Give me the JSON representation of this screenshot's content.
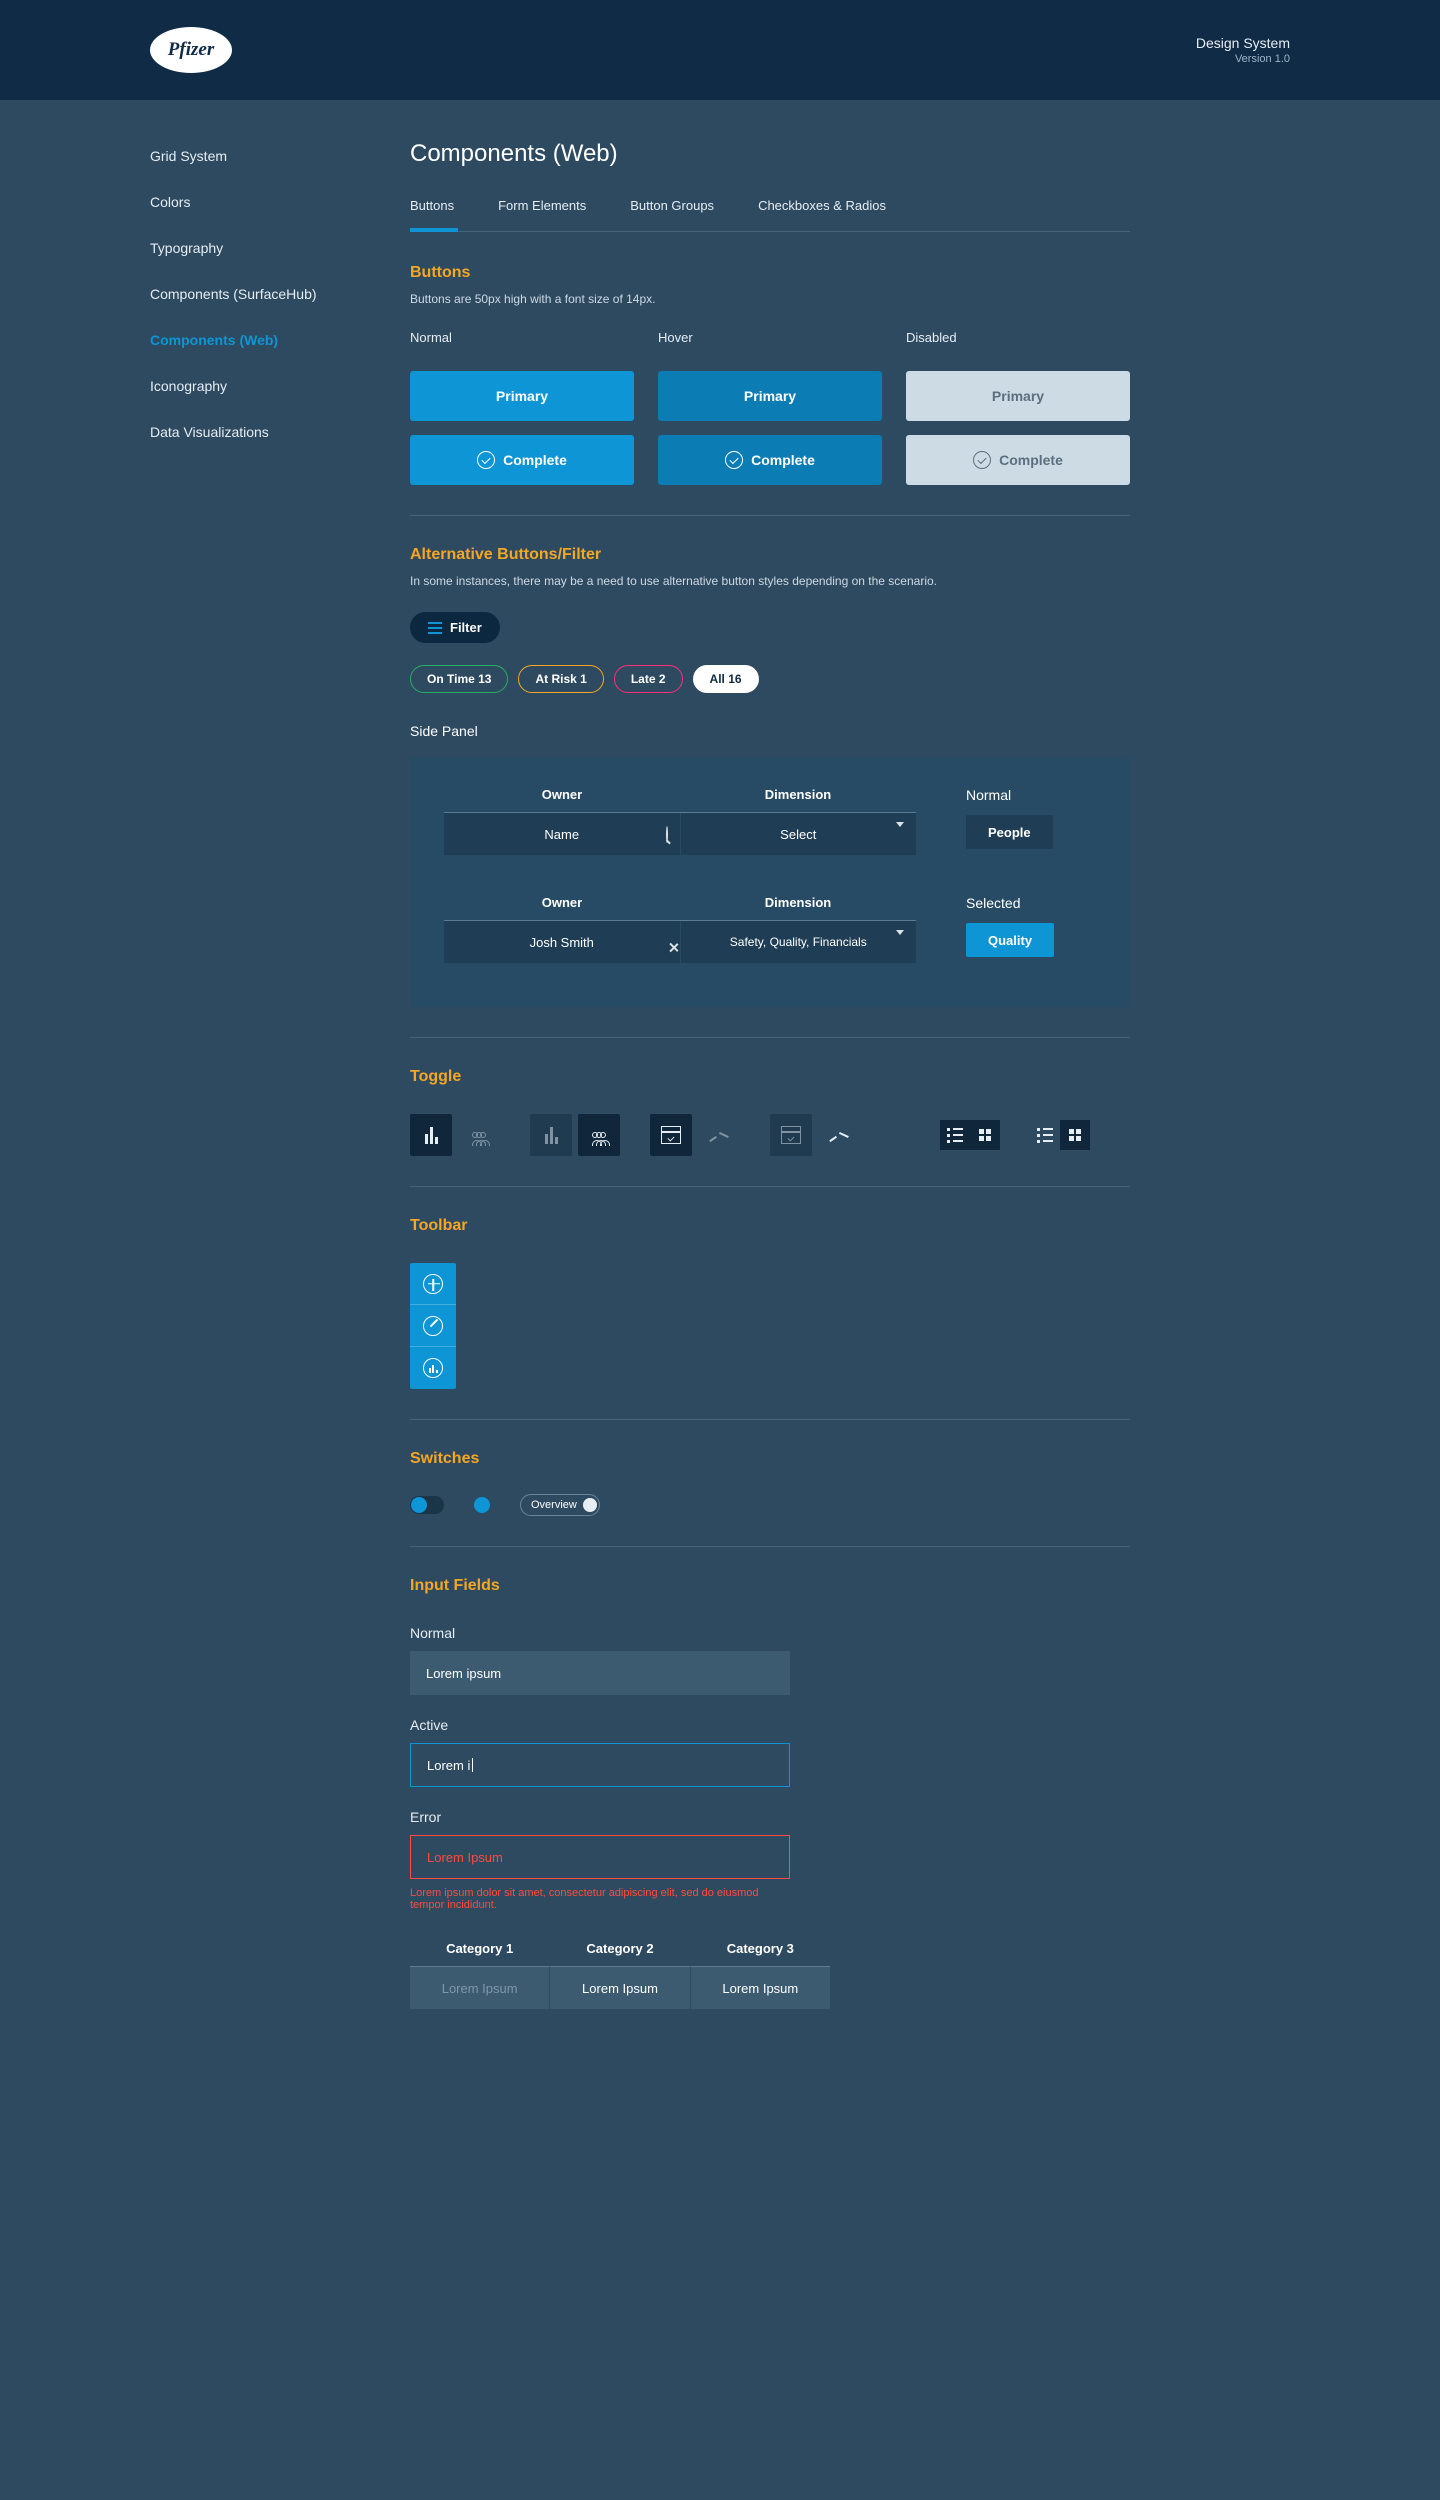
{
  "header": {
    "brand": "Pfizer",
    "title": "Design System",
    "version": "Version 1.0"
  },
  "sidebar": {
    "items": [
      {
        "label": "Grid System"
      },
      {
        "label": "Colors"
      },
      {
        "label": "Typography"
      },
      {
        "label": "Components (SurfaceHub)"
      },
      {
        "label": "Components (Web)",
        "active": true
      },
      {
        "label": "Iconography"
      },
      {
        "label": "Data Visualizations"
      }
    ]
  },
  "page": {
    "title": "Components (Web)"
  },
  "tabs": [
    {
      "label": "Buttons",
      "active": true
    },
    {
      "label": "Form Elements"
    },
    {
      "label": "Button Groups"
    },
    {
      "label": "Checkboxes & Radios"
    }
  ],
  "buttons": {
    "title": "Buttons",
    "desc": "Buttons are 50px high with a font size of 14px.",
    "states": {
      "normal": "Normal",
      "hover": "Hover",
      "disabled": "Disabled"
    },
    "primary_label": "Primary",
    "complete_label": "Complete"
  },
  "alt": {
    "title": "Alternative Buttons/Filter",
    "desc": "In some instances, there may be a need to use alternative button styles depending on the scenario.",
    "filter_label": "Filter",
    "pills": {
      "ontime": "On Time 13",
      "atrisk": "At Risk 1",
      "late": "Late 2",
      "all": "All 16"
    }
  },
  "sidepanel": {
    "title": "Side Panel",
    "owner_header": "Owner",
    "dimension_header": "Dimension",
    "normal": {
      "label": "Normal",
      "owner": "Name",
      "dimension": "Select",
      "chip": "People"
    },
    "selected": {
      "label": "Selected",
      "owner": "Josh Smith",
      "dimension": "Safety, Quality, Financials",
      "chip": "Quality"
    }
  },
  "toggle": {
    "title": "Toggle"
  },
  "toolbar": {
    "title": "Toolbar"
  },
  "switches": {
    "title": "Switches",
    "overview": "Overview"
  },
  "inputs": {
    "title": "Input Fields",
    "normal_label": "Normal",
    "normal_value": "Lorem ipsum",
    "active_label": "Active",
    "active_value": "Lorem i",
    "error_label": "Error",
    "error_value": "Lorem Ipsum",
    "error_msg": "Lorem ipsum dolor sit amet, consectetur adipiscing elit, sed do eiusmod tempor incididunt."
  },
  "categories": {
    "headers": [
      "Category 1",
      "Category 2",
      "Category 3"
    ],
    "values": [
      "Lorem Ipsum",
      "Lorem Ipsum",
      "Lorem Ipsum"
    ]
  }
}
